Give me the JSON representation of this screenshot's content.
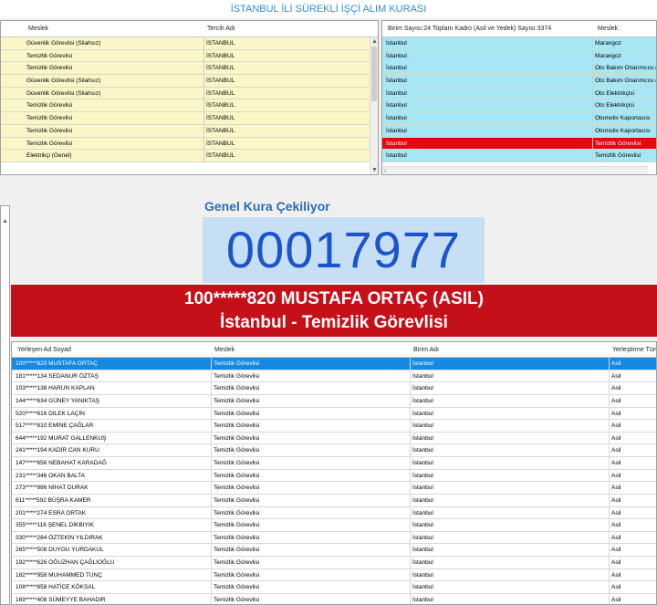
{
  "app": {
    "title": "İSTANBUL İLİ SÜREKLİ İŞÇİ ALIM KURASI"
  },
  "top_left_grid": {
    "headers": [
      "Meslek",
      "Tercih Adı"
    ],
    "rows": [
      [
        "Güvenlik Görevlisi (Silahsız)",
        "İSTANBUL"
      ],
      [
        "Temizlik Görevlisi",
        "İSTANBUL"
      ],
      [
        "Temizlik Görevlisi",
        "İSTANBUL"
      ],
      [
        "Güvenlik Görevlisi (Silahsız)",
        "İSTANBUL"
      ],
      [
        "Güvenlik Görevlisi (Silahsız)",
        "İSTANBUL"
      ],
      [
        "Temizlik Görevlisi",
        "İSTANBUL"
      ],
      [
        "Temizlik Görevlisi",
        "İSTANBUL"
      ],
      [
        "Temizlik Görevlisi",
        "İSTANBUL"
      ],
      [
        "Temizlik Görevlisi",
        "İSTANBUL"
      ],
      [
        "Elektrikçi (Genel)",
        "İSTANBUL"
      ]
    ]
  },
  "top_right_grid": {
    "headers": [
      "Birim Sayısı:24 Toplam Kadro (Asil ve Yedek) Sayısı:3374",
      "Meslek"
    ],
    "rows": [
      [
        "İstanbul",
        "Marangoz"
      ],
      [
        "İstanbul",
        "Marangoz"
      ],
      [
        "İstanbul",
        "Oto Bakım Onarımcısı (C"
      ],
      [
        "İstanbul",
        "Oto Bakım Onarımcısı (C"
      ],
      [
        "İstanbul",
        "Oto Elektrikçisi"
      ],
      [
        "İstanbul",
        "Oto Elektrikçisi"
      ],
      [
        "İstanbul",
        "Otomotiv Kaportacısı"
      ],
      [
        "İstanbul",
        "Otomotiv Kaportacısı"
      ],
      [
        "İstanbul",
        "Temizlik Görevlisi"
      ],
      [
        "İstanbul",
        "Temizlik Görevlisi"
      ]
    ],
    "selected_row": 8
  },
  "draw": {
    "label": "Genel Kura Çekiliyor",
    "number": "00017977",
    "winner_line1": "100*****820 MUSTAFA ORTAÇ (ASIL)",
    "winner_line2": "İstanbul - Temizlik Görevlisi"
  },
  "results_grid": {
    "headers": [
      "Yerleşen Ad Soyad",
      "Meslek",
      "Birim Adı",
      "Yerleştirme Türü"
    ],
    "rows": [
      [
        "100*****820 MUSTAFA ORTAÇ",
        "Temizlik Görevlisi",
        "İstanbul",
        "Asil"
      ],
      [
        "181*****134 SEDANUR ÖZTAŞ",
        "Temizlik Görevlisi",
        "İstanbul",
        "Asil"
      ],
      [
        "103*****138 HARUN KAPLAN",
        "Temizlik Görevlisi",
        "İstanbul",
        "Asil"
      ],
      [
        "144*****634 GÜNEY YANIKTAŞ",
        "Temizlik Görevlisi",
        "İstanbul",
        "Asil"
      ],
      [
        "520*****616 DİLEK LAÇİN",
        "Temizlik Görevlisi",
        "İstanbul",
        "Asil"
      ],
      [
        "517*****810 EMİNE ÇAĞLAR",
        "Temizlik Görevlisi",
        "İstanbul",
        "Asil"
      ],
      [
        "644*****192 MURAT GALLENKUŞ",
        "Temizlik Görevlisi",
        "İstanbul",
        "Asil"
      ],
      [
        "241*****194 KADİR CAN KURU",
        "Temizlik Görevlisi",
        "İstanbul",
        "Asil"
      ],
      [
        "147*****656 NEBAHAT KARADAĞ",
        "Temizlik Görevlisi",
        "İstanbul",
        "Asil"
      ],
      [
        "231*****346 OKAN BALTA",
        "Temizlik Görevlisi",
        "İstanbul",
        "Asil"
      ],
      [
        "273*****986 NİHAT DURAK",
        "Temizlik Görevlisi",
        "İstanbul",
        "Asil"
      ],
      [
        "611*****592 BÜŞRA KAMER",
        "Temizlik Görevlisi",
        "İstanbul",
        "Asil"
      ],
      [
        "201*****274 ESRA ORTAK",
        "Temizlik Görevlisi",
        "İstanbul",
        "Asil"
      ],
      [
        "355*****116 ŞENEL DİKBIYIK",
        "Temizlik Görevlisi",
        "İstanbul",
        "Asil"
      ],
      [
        "330*****284 ÖZTEKİN YILDIRAK",
        "Temizlik Görevlisi",
        "İstanbul",
        "Asil"
      ],
      [
        "265*****508 DUYGU YURDAKUL",
        "Temizlik Görevlisi",
        "İstanbul",
        "Asil"
      ],
      [
        "192*****626 OĞUZHAN ÇAĞLIOĞLU",
        "Temizlik Görevlisi",
        "İstanbul",
        "Asil"
      ],
      [
        "182*****958 MUHAMMED TUNÇ",
        "Temizlik Görevlisi",
        "İstanbul",
        "Asil"
      ],
      [
        "108*****858 HATİCE KÖKSAL",
        "Temizlik Görevlisi",
        "İstanbul",
        "Asil"
      ],
      [
        "169*****408 SÜMEYYE BAHADIR",
        "Temizlik Görevlisi",
        "İstanbul",
        "Asil"
      ]
    ],
    "selected_row": 0
  },
  "icons": {
    "scroll_up": "chevron-up-icon",
    "scroll_down": "chevron-down-icon",
    "scroll_left": "chevron-left-icon"
  },
  "colors": {
    "left_grid_bg": "#fbf6c8",
    "right_grid_bg": "#a7e6f4",
    "highlight_red": "#e30613",
    "banner_red": "#c5101a",
    "selection_blue": "#1789e0",
    "number_blue": "#1d54c9"
  }
}
